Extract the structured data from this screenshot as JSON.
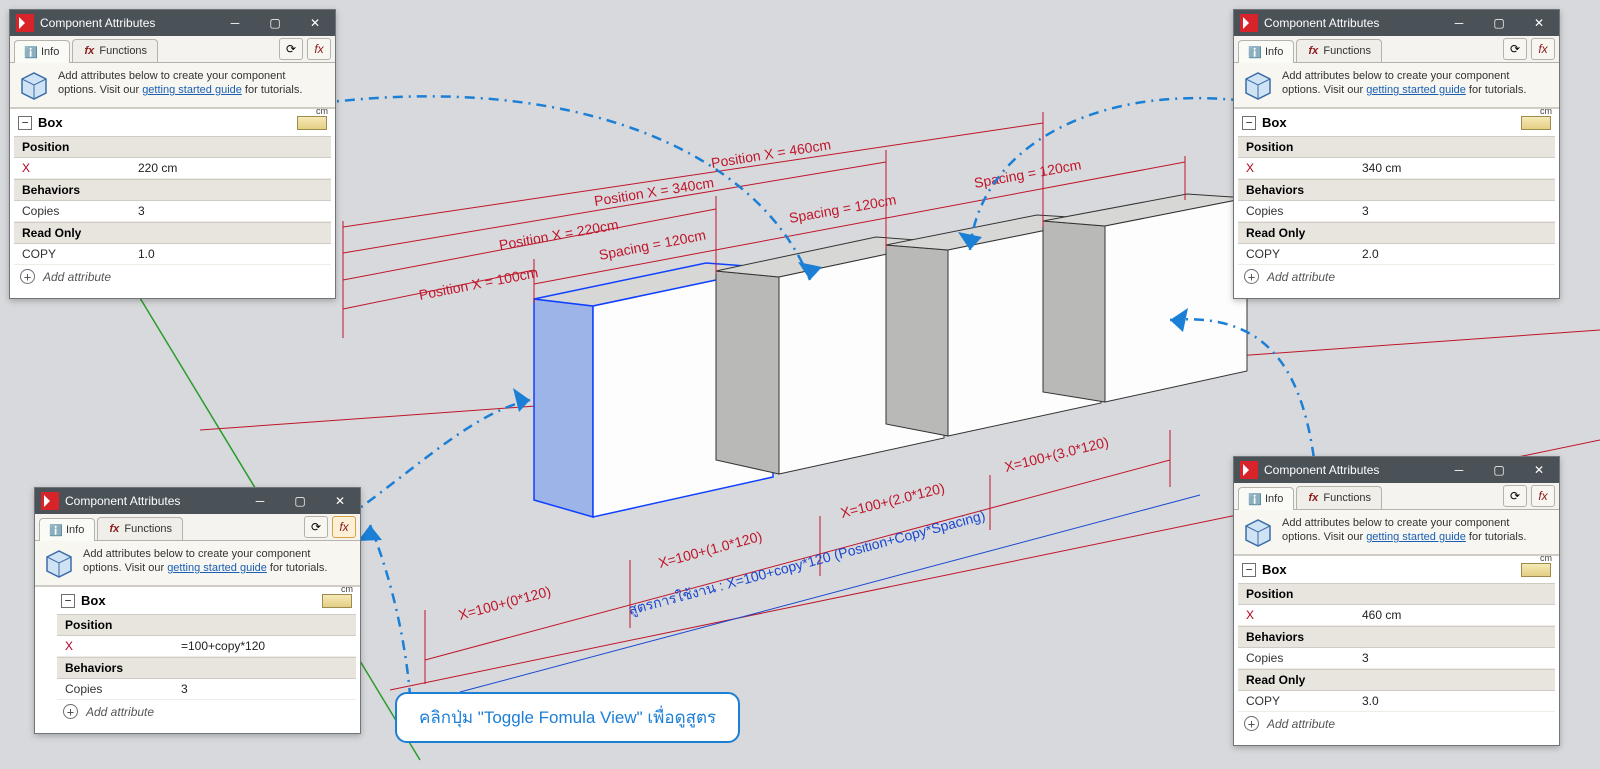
{
  "note_text": "คลิกปุ่ม \"Toggle Fomula View\" เพื่อดูสูตร",
  "hint": {
    "prefix": "Add attributes below to create your component options. Visit our ",
    "link": "getting started guide",
    "suffix": " for tutorials."
  },
  "tabs": {
    "info": "Info",
    "functions": "Functions"
  },
  "labels": {
    "position": "Position",
    "behaviors": "Behaviors",
    "read_only": "Read Only",
    "copies": "Copies",
    "copy_ro": "COPY",
    "x": "X",
    "add_attribute": "Add attribute"
  },
  "panels": {
    "top_left": {
      "title": "Component Attributes",
      "name": "Box",
      "x": "220 cm",
      "copies": "3",
      "copy": "1.0"
    },
    "top_right": {
      "title": "Component Attributes",
      "name": "Box",
      "x": "340 cm",
      "copies": "3",
      "copy": "2.0"
    },
    "bottom_left": {
      "title": "Component Attributes",
      "name": "Box",
      "x_formula": "=100+copy*120",
      "copies": "3"
    },
    "bottom_right": {
      "title": "Component Attributes",
      "name": "Box",
      "x": "460 cm",
      "copies": "3",
      "copy": "3.0"
    }
  },
  "dimensions": {
    "pos_labels": [
      "Position X = 100cm",
      "Position X = 220cm",
      "Position X = 340cm",
      "Position X = 460cm"
    ],
    "spacing": "Spacing = 120cm",
    "bottom_calc": [
      "X=100+(0*120)",
      "X=100+(1.0*120)",
      "X=100+(2.0*120)",
      "X=100+(3.0*120)"
    ],
    "formula_note": "สูตรการใช้งาน : X=100+copy*120 (Position+Copy*Spacing)"
  }
}
